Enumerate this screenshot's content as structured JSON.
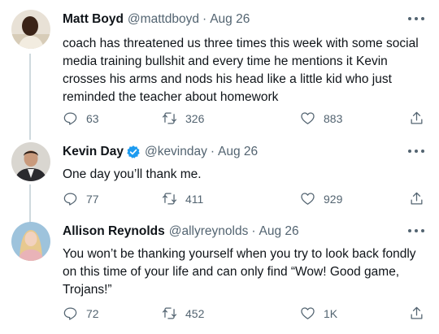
{
  "tweets": [
    {
      "name": "Matt Boyd",
      "handle": "@mattdboyd",
      "dot": "·",
      "date": "Aug 26",
      "text": "coach has threatened us three times this week with some social media training bullshit and every time he mentions it Kevin crosses his arms and nods his head like a little kid who just reminded the teacher about homework",
      "replies": "63",
      "retweets": "326",
      "likes": "883"
    },
    {
      "name": "Kevin Day",
      "handle": "@kevinday",
      "dot": "·",
      "date": "Aug 26",
      "verified": true,
      "text": "One day you’ll thank me.",
      "replies": "77",
      "retweets": "411",
      "likes": "929"
    },
    {
      "name": "Allison Reynolds",
      "handle": "@allyreynolds",
      "dot": "·",
      "date": "Aug 26",
      "text": "You won’t be thanking yourself when you try to look back fondly on this time of your life and can only find “Wow! Good game, Trojans!”",
      "replies": "72",
      "retweets": "452",
      "likes": "1K"
    }
  ],
  "icons": {
    "reply": "reply-icon",
    "retweet": "retweet-icon",
    "like": "heart-icon",
    "share": "share-icon",
    "more": "more-icon",
    "verified": "verified-badge-icon"
  },
  "colors": {
    "text": "#0f1419",
    "muted": "#536471",
    "verified": "#1d9bf0",
    "thread_line": "#cfd9de"
  }
}
